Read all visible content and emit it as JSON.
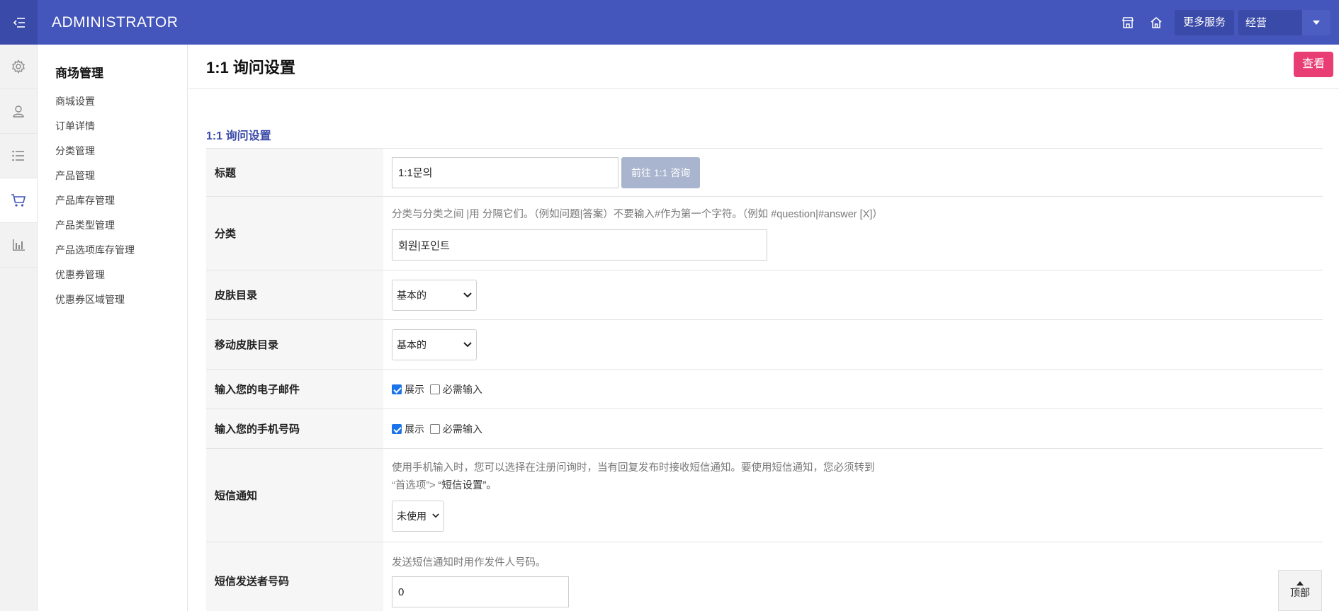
{
  "header": {
    "brand": "ADMINISTRATOR",
    "more_services": "更多服务",
    "user": "经营"
  },
  "rail": {
    "items": [
      "gear-icon",
      "user-icon",
      "list-icon",
      "cart-icon",
      "chart-icon"
    ],
    "active": "cart-icon"
  },
  "subnav": {
    "title": "商场管理",
    "items": [
      "商城设置",
      "订单详情",
      "分类管理",
      "产品管理",
      "产品库存管理",
      "产品类型管理",
      "产品选项库存管理",
      "优惠券管理",
      "优惠券区域管理"
    ]
  },
  "page": {
    "title": "1:1 询问设置",
    "view_button": "查看",
    "section_title": "1:1 询问设置"
  },
  "form": {
    "title": {
      "label": "标题",
      "value": "1:1문의",
      "button": "前往 1:1 咨询"
    },
    "category": {
      "label": "分类",
      "help": "分类与分类之间 |用 分隔它们。（例如问题|答案）不要输入#作为第一个字符。（例如 #question|#answer [X]）",
      "value": "회원|포인트"
    },
    "skin": {
      "label": "皮肤目录",
      "value": "基本的"
    },
    "mobile_skin": {
      "label": "移动皮肤目录",
      "value": "基本的"
    },
    "email": {
      "label": "输入您的电子邮件",
      "show_label": "展示",
      "show_checked": true,
      "required_label": "必需输入",
      "required_checked": false
    },
    "phone": {
      "label": "输入您的手机号码",
      "show_label": "展示",
      "show_checked": true,
      "required_label": "必需输入",
      "required_checked": false
    },
    "sms": {
      "label": "短信通知",
      "help_line1": "使用手机输入时，您可以选择在注册问询时，当有回复发布时接收短信通知。要使用短信通知，您必须转到",
      "help_line2_pre": "“首选项”> ",
      "help_line2_bold": "“短信设置”",
      "help_line2_post": "。",
      "value": "未使用"
    },
    "sender": {
      "label": "短信发送者号码",
      "help": "发送短信通知时用作发件人号码。",
      "value": "0"
    }
  },
  "scroll_top": "顶部"
}
